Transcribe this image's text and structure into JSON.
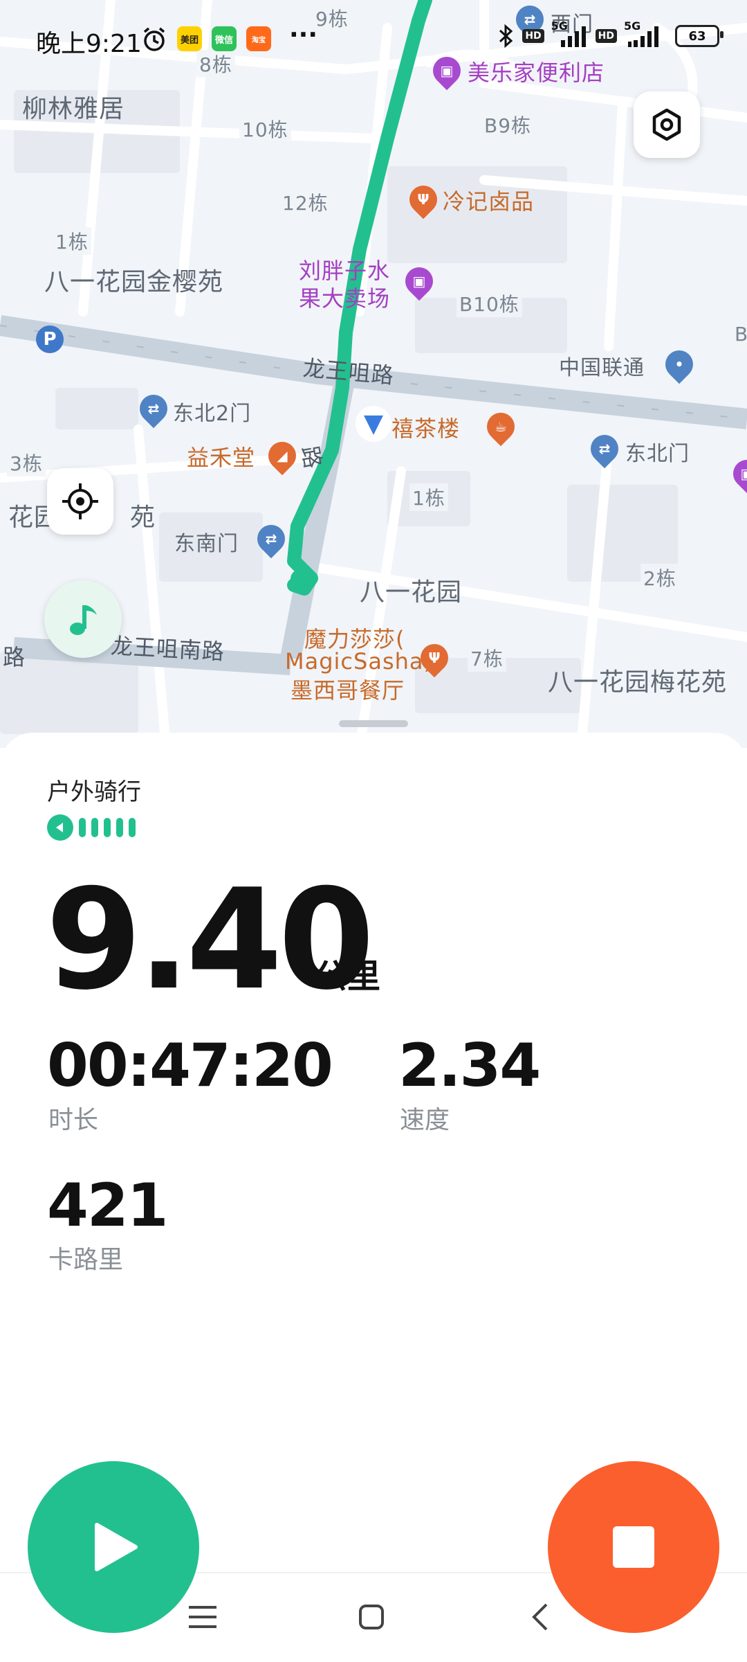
{
  "status_bar": {
    "time": "晚上9:21",
    "apps": [
      "美团",
      "微信",
      "淘宝"
    ],
    "more": "···",
    "network_1": "5G",
    "network_2": "5G",
    "hd": "HD",
    "battery": "63"
  },
  "map": {
    "labels": {
      "b9_top": "9栋",
      "b8": "8栋",
      "b10": "10栋",
      "b12": "12栋",
      "b1_left": "1栋",
      "b3": "3栋",
      "b1_mid": "1栋",
      "b2": "2栋",
      "b7": "7栋",
      "bB9": "B9栋",
      "bB10": "B10栋",
      "liulin": "柳林雅居",
      "bayi_jinying": "八一花园金樱苑",
      "huayuan_left": "花园",
      "huayuan_left2": "苑",
      "bayi_huayuan": "八一花园",
      "bayi_meihua": "八一花园梅花苑",
      "xi_gate": "西门",
      "meile_store": "美乐家便利店",
      "lengji": "冷记卤品",
      "liupang_1": "刘胖子水",
      "liupang_2": "果大卖场",
      "longwang_road": "龙王咀路",
      "longwang_south": "龙王咀南路",
      "road_fragment": "路",
      "china_unicom": "中国联通",
      "dongbei_2": "东北2门",
      "dongbei": "东北门",
      "xi_tea": "禧茶楼",
      "yihe": "益禾堂",
      "dongnan": "东南门",
      "magic_1": "魔力莎莎(",
      "magic_2": "MagicSasha)",
      "magic_3": "墨西哥餐厅",
      "lane_1": "路",
      "b_edge": "B",
      "parking": "P"
    },
    "icons": {
      "settings": "hexagon-settings-icon",
      "locate": "crosshair-locate-icon",
      "music": "music-note-icon"
    },
    "route_color": "#23c08f"
  },
  "workout": {
    "activity": "户外骑行",
    "distance": "9.40",
    "distance_unit": "公里",
    "duration": "00:47:20",
    "duration_label": "时长",
    "speed": "2.34",
    "speed_label": "速度",
    "calories": "421",
    "calories_label": "卡路里",
    "gps_signal_bars": 5
  },
  "colors": {
    "accent_green": "#23c08f",
    "stop_orange": "#fb5f2e"
  }
}
